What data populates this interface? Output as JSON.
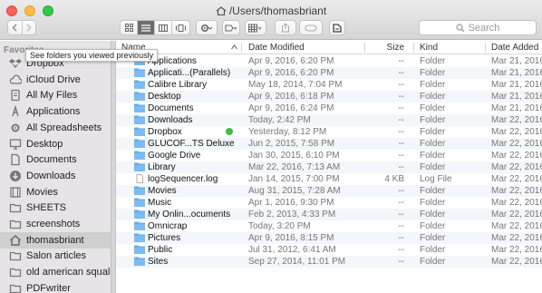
{
  "window": {
    "title": "/Users/thomasbriant",
    "search_placeholder": "Search",
    "colors": {
      "selection": "#d0cfd0",
      "folder": "#61a8e8",
      "sync_badge": "#3dbb46"
    }
  },
  "tooltip": "See folders you viewed previously",
  "sidebar": {
    "heading": "Favorites",
    "items": [
      {
        "label": "Dropbox",
        "icon": "dropbox-icon"
      },
      {
        "label": "iCloud Drive",
        "icon": "cloud-icon"
      },
      {
        "label": "All My Files",
        "icon": "files-icon"
      },
      {
        "label": "Applications",
        "icon": "applications-icon"
      },
      {
        "label": "All Spreadsheets",
        "icon": "gear-icon"
      },
      {
        "label": "Desktop",
        "icon": "desktop-icon"
      },
      {
        "label": "Documents",
        "icon": "document-icon"
      },
      {
        "label": "Downloads",
        "icon": "download-icon"
      },
      {
        "label": "Movies",
        "icon": "film-icon"
      },
      {
        "label": "SHEETS",
        "icon": "folder-icon"
      },
      {
        "label": "screenshots",
        "icon": "folder-icon"
      },
      {
        "label": "thomasbriant",
        "icon": "home-icon",
        "selected": true
      },
      {
        "label": "Salon articles",
        "icon": "folder-icon"
      },
      {
        "label": "old american squalor",
        "icon": "folder-icon"
      },
      {
        "label": "PDFwriter",
        "icon": "folder-icon"
      }
    ]
  },
  "columns": {
    "name": "Name",
    "date": "Date Modified",
    "size": "Size",
    "kind": "Kind",
    "added": "Date Added"
  },
  "files": [
    {
      "name": "Applications",
      "date": "Apr 9, 2016, 6:20 PM",
      "size": "--",
      "kind": "Folder",
      "added": "Mar 21, 2016,"
    },
    {
      "name": "Applicati...(Parallels)",
      "date": "Apr 9, 2016, 6:20 PM",
      "size": "--",
      "kind": "Folder",
      "added": "Mar 21, 2016,"
    },
    {
      "name": "Calibre Library",
      "date": "May 18, 2014, 7:04 PM",
      "size": "--",
      "kind": "Folder",
      "added": "Mar 21, 2016,"
    },
    {
      "name": "Desktop",
      "date": "Apr 9, 2016, 6:18 PM",
      "size": "--",
      "kind": "Folder",
      "added": "Mar 21, 2016,"
    },
    {
      "name": "Documents",
      "date": "Apr 9, 2016, 6:24 PM",
      "size": "--",
      "kind": "Folder",
      "added": "Mar 21, 2016,"
    },
    {
      "name": "Downloads",
      "date": "Today, 2:42 PM",
      "size": "--",
      "kind": "Folder",
      "added": "Mar 22, 2016,"
    },
    {
      "name": "Dropbox",
      "date": "Yesterday, 8:12 PM",
      "size": "--",
      "kind": "Folder",
      "added": "Mar 22, 2016,",
      "badge": true
    },
    {
      "name": "GLUCOF...TS Deluxe",
      "date": "Jun 2, 2015, 7:58 PM",
      "size": "--",
      "kind": "Folder",
      "added": "Mar 22, 2016,"
    },
    {
      "name": "Google Drive",
      "date": "Jan 30, 2015, 6:10 PM",
      "size": "--",
      "kind": "Folder",
      "added": "Mar 22, 2016,"
    },
    {
      "name": "Library",
      "date": "Mar 22, 2016, 7:13 AM",
      "size": "--",
      "kind": "Folder",
      "added": "Mar 22, 2016,"
    },
    {
      "name": "logSequencer.log",
      "date": "Jan 14, 2015, 7:00 PM",
      "size": "4 KB",
      "kind": "Log File",
      "added": "Mar 22, 2016,",
      "file": true
    },
    {
      "name": "Movies",
      "date": "Aug 31, 2015, 7:28 AM",
      "size": "--",
      "kind": "Folder",
      "added": "Mar 22, 2016,"
    },
    {
      "name": "Music",
      "date": "Apr 1, 2016, 9:30 PM",
      "size": "--",
      "kind": "Folder",
      "added": "Mar 22, 2016,"
    },
    {
      "name": "My Onlin...ocuments",
      "date": "Feb 2, 2013, 4:33 PM",
      "size": "--",
      "kind": "Folder",
      "added": "Mar 22, 2016,"
    },
    {
      "name": "Omnicrap",
      "date": "Today, 3:20 PM",
      "size": "--",
      "kind": "Folder",
      "added": "Mar 22, 2016,"
    },
    {
      "name": "Pictures",
      "date": "Apr 9, 2016, 8:15 PM",
      "size": "--",
      "kind": "Folder",
      "added": "Mar 22, 2016,"
    },
    {
      "name": "Public",
      "date": "Jul 31, 2012, 6:41 AM",
      "size": "--",
      "kind": "Folder",
      "added": "Mar 22, 2016,"
    },
    {
      "name": "Sites",
      "date": "Sep 27, 2014, 11:01 PM",
      "size": "--",
      "kind": "Folder",
      "added": "Mar 22, 2016,"
    }
  ]
}
